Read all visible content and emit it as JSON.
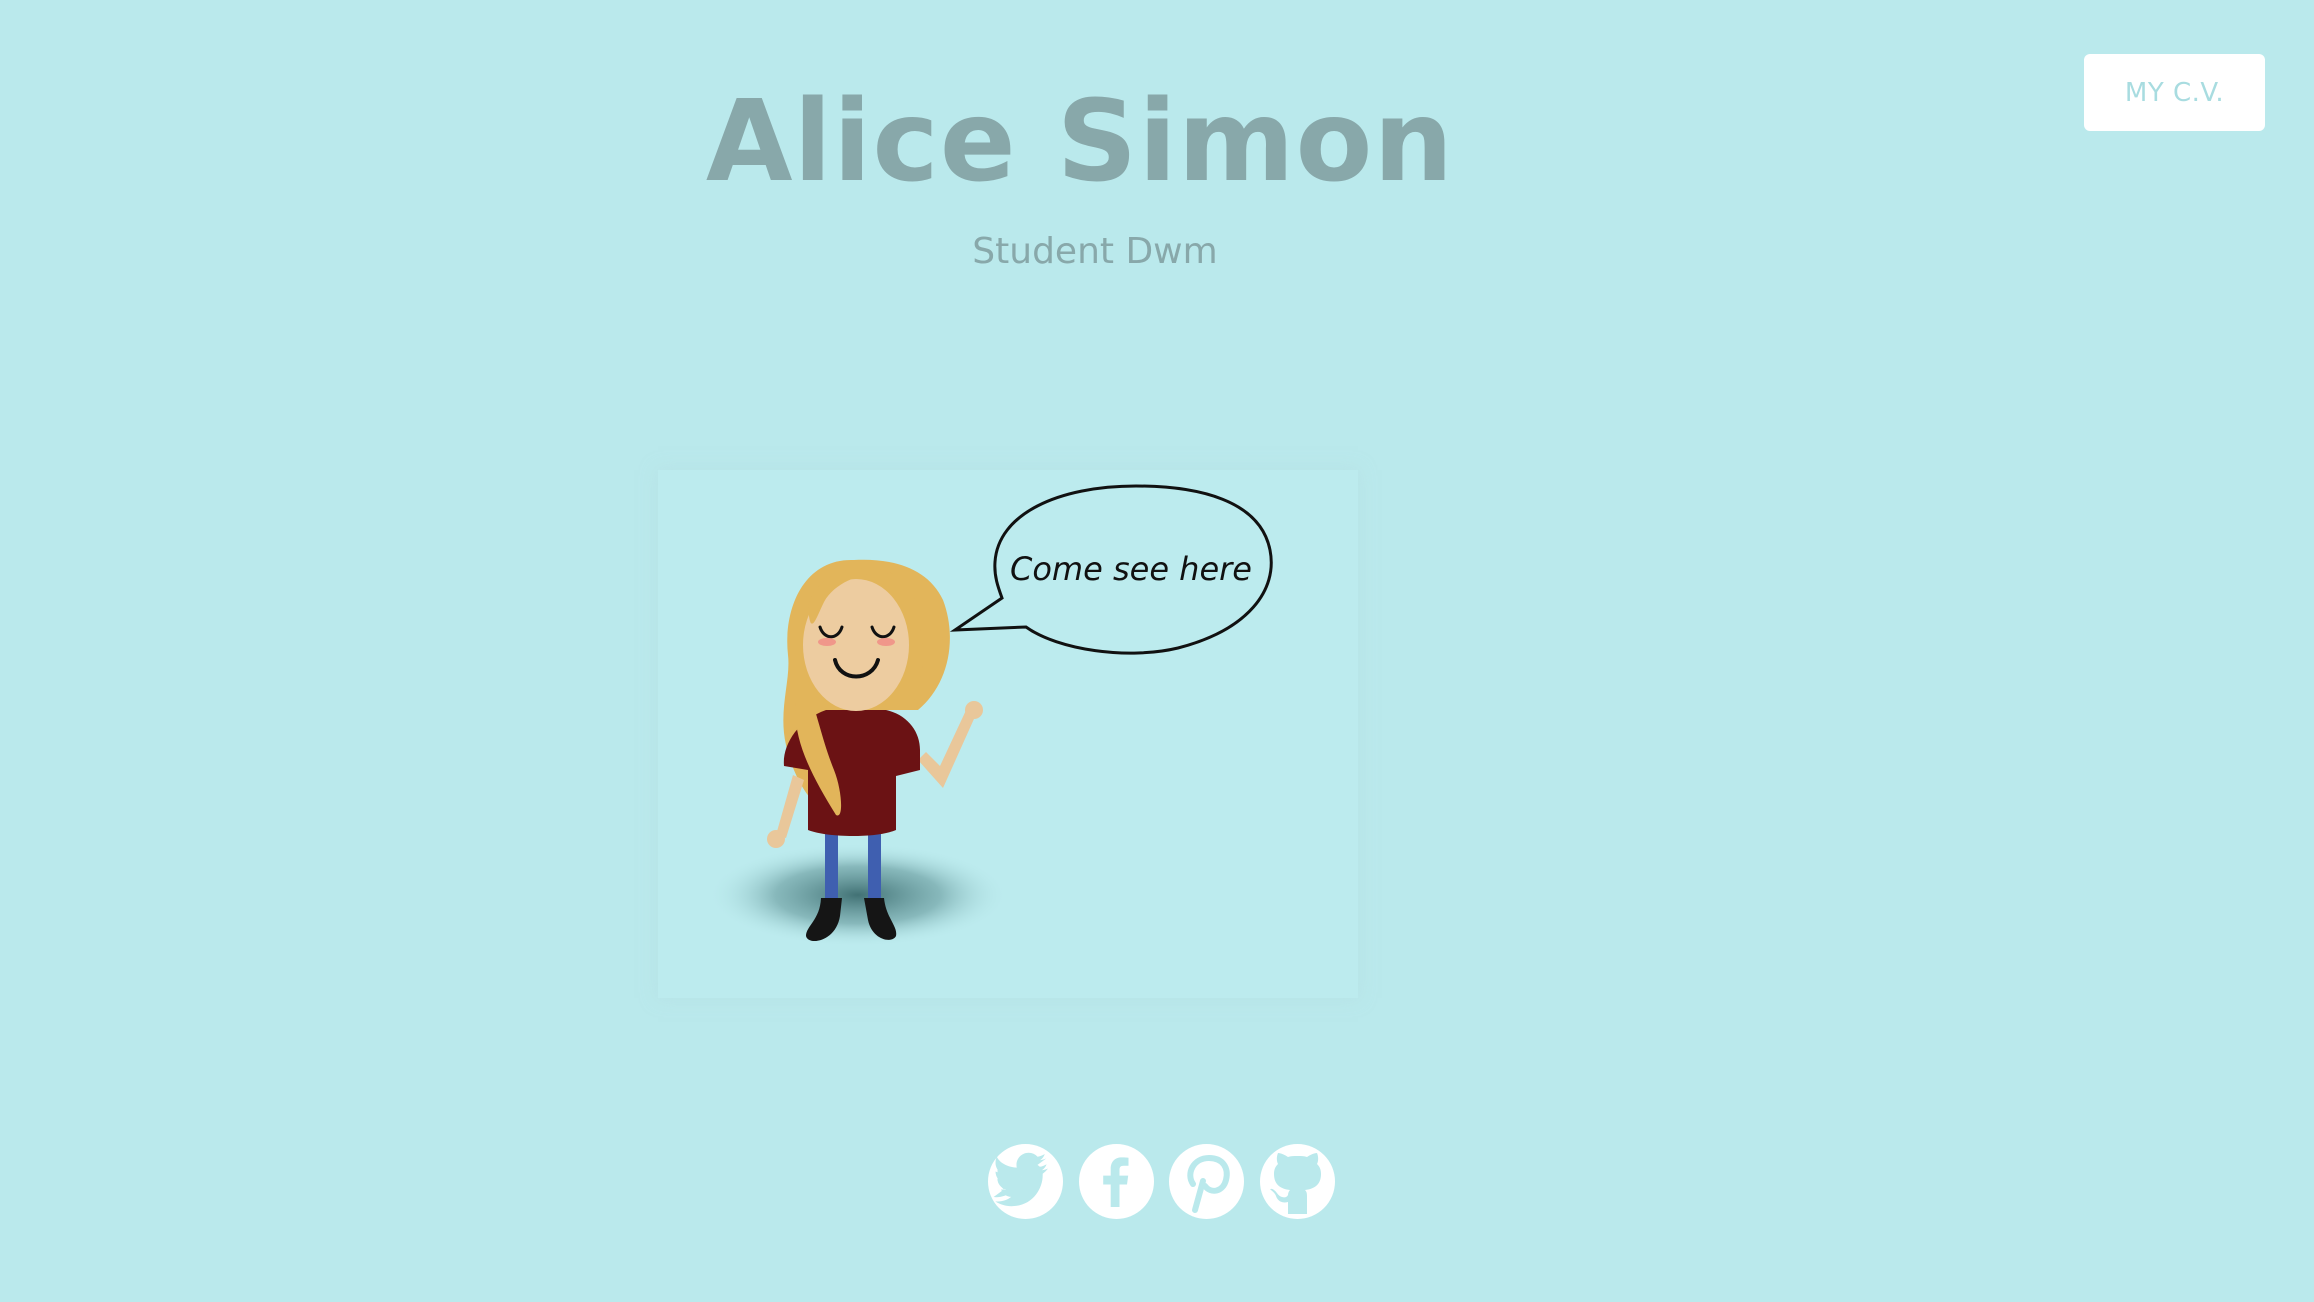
{
  "header": {
    "cv_button_label": "MY C.V."
  },
  "hero": {
    "name": "Alice Simon",
    "subtitle": "Student Dwm"
  },
  "illustration": {
    "speech_text": "Come see here",
    "character": "girl-waving-character"
  },
  "social": {
    "links": [
      {
        "name": "Twitter",
        "icon": "twitter-icon"
      },
      {
        "name": "Facebook",
        "icon": "facebook-icon"
      },
      {
        "name": "Pinterest",
        "icon": "pinterest-icon"
      },
      {
        "name": "GitHub",
        "icon": "github-icon"
      }
    ]
  },
  "colors": {
    "background": "#bae9ec",
    "title_text": "#88a8aa",
    "button_bg": "#ffffff",
    "button_text": "#a8dce0",
    "icon_fg": "#bae9ec"
  }
}
